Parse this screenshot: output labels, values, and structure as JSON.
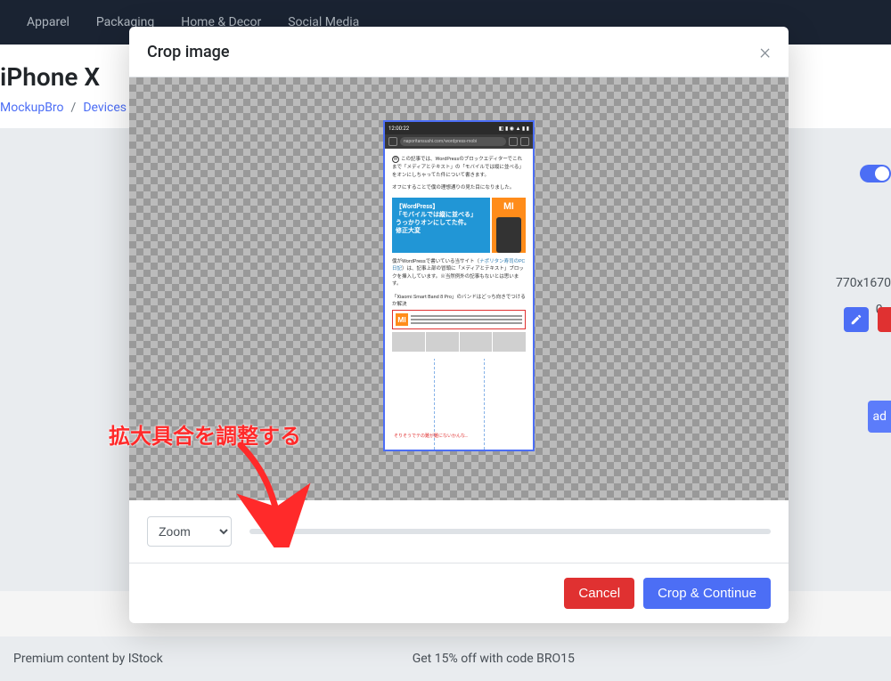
{
  "nav": {
    "items": [
      "Apparel",
      "Packaging",
      "Home & Decor",
      "Social Media"
    ]
  },
  "page": {
    "title": "iPhone X",
    "breadcrumb": [
      "MockupBro",
      "Devices"
    ]
  },
  "right": {
    "dimensions": "770x1670",
    "ellipsis": "0…",
    "download_stub": "ad"
  },
  "footer": {
    "premium": "Premium content by IStock",
    "promo": "Get 15% off with code BRO15"
  },
  "modal": {
    "title": "Crop image",
    "zoom_label": "Zoom",
    "cancel": "Cancel",
    "continue": "Crop & Continue"
  },
  "annotation": {
    "label": "拡大具合を調整する"
  },
  "phone": {
    "time": "12:00:22",
    "url": "naporitansushi.com/wordpress-mobi",
    "paragraph1": "この記事では、WordPressのブロックエディターでこれまで「メディアとテキスト」の「モバイルでは縦に並べる」をオンにしちゃってた件について書きます。",
    "paragraph2": "オフにすることで僕の理想通りの見た目になりました。",
    "featured_title": "【WordPress】\n「モバイルでは縦に並べる」\nうっかりオンにしてた件。\n修正大変",
    "mi_logo": "MI",
    "paragraph3_pre": "僕がWordPressで書いている当サイト（",
    "paragraph3_link": "ナポリタン寿司のPC日記",
    "paragraph3_post": "）は、記事上部の冒頭に「メディアとテキスト」ブロックを挿入しています。※当然例外の記事もないとは思います。",
    "sep_text": "「Xiaomi Smart Band 8 Pro」のバンドはどっち向きでつけるか解決",
    "bottom_caption": "そりそうでテの難が難にないかんな…"
  }
}
